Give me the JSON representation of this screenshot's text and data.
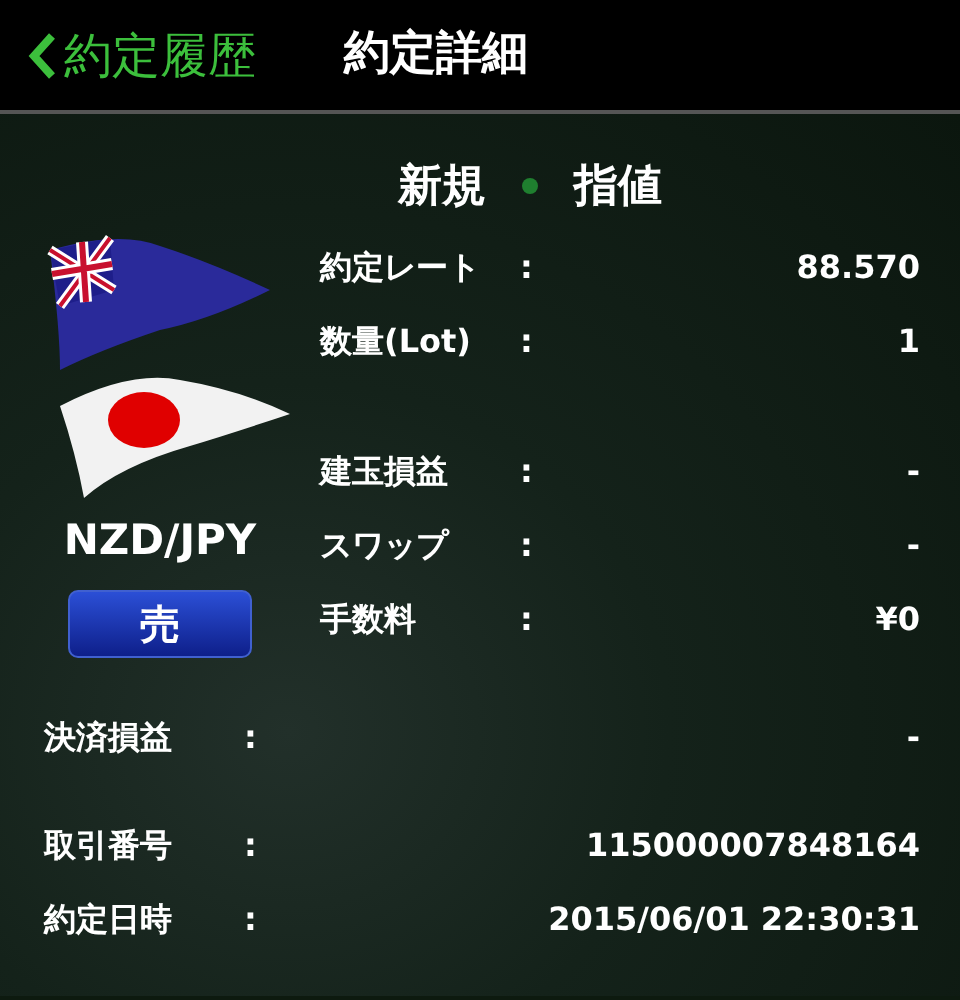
{
  "nav": {
    "back_label": "約定履歴",
    "title": "約定詳細"
  },
  "order": {
    "type": "新規",
    "execution": "指値"
  },
  "pair": "NZD/JPY",
  "side": "売",
  "rate_rows": [
    {
      "label": "約定レート",
      "colon": ":",
      "value": "88.570"
    },
    {
      "label": "数量(Lot)",
      "colon": ":",
      "value": "1"
    }
  ],
  "pl_rows": [
    {
      "label": "建玉損益",
      "colon": ":",
      "value": "-"
    },
    {
      "label": "スワップ",
      "colon": ":",
      "value": "-"
    },
    {
      "label": "手数料",
      "colon": ":",
      "value": "¥0"
    }
  ],
  "settlement_rows": [
    {
      "label": "決済損益",
      "colon": ":",
      "value": "-"
    }
  ],
  "trade_rows": [
    {
      "label": "取引番号",
      "colon": ":",
      "value": "115000007848164"
    },
    {
      "label": "約定日時",
      "colon": ":",
      "value": "2015/06/01 22:30:31"
    }
  ]
}
